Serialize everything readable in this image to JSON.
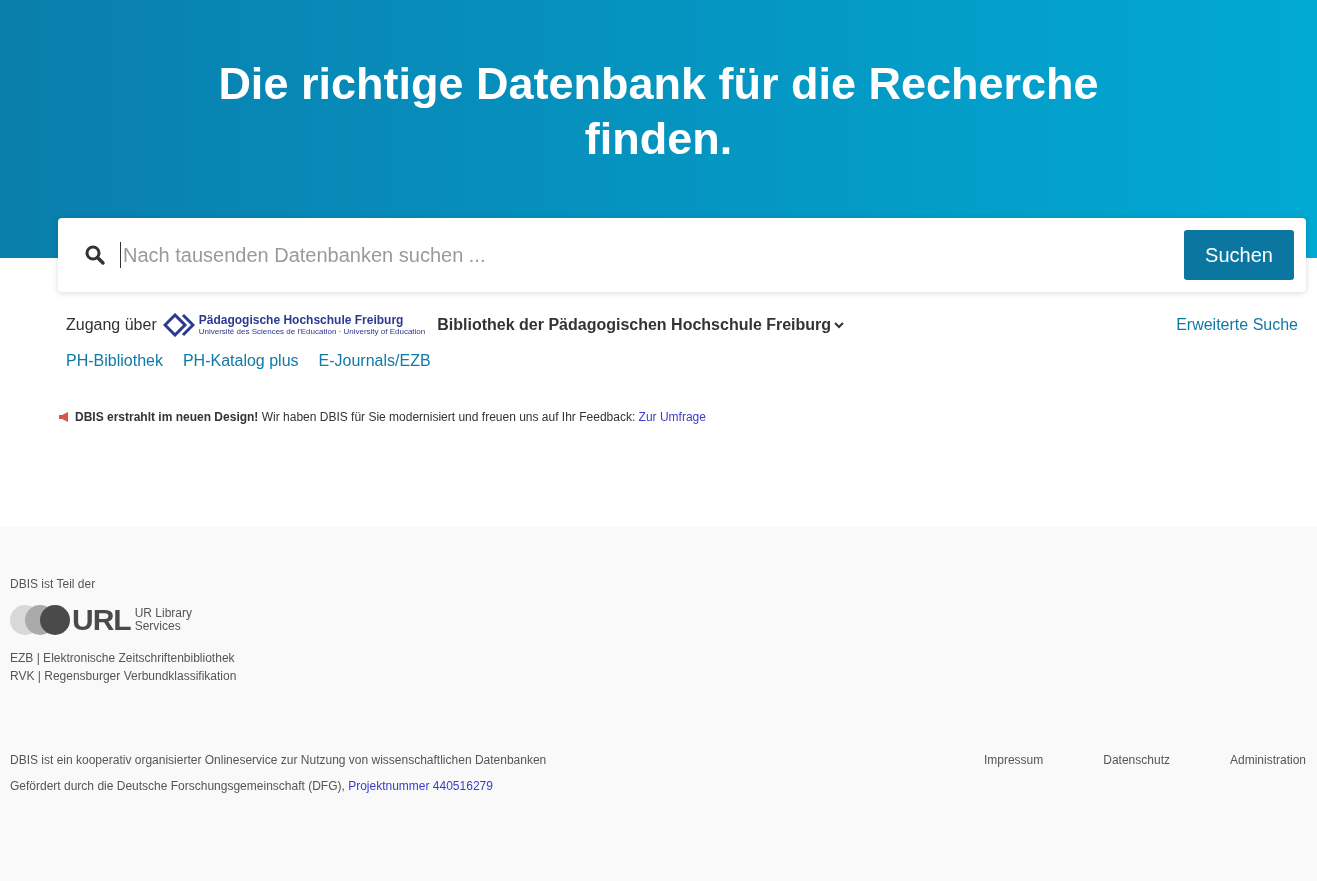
{
  "hero": {
    "title": "Die richtige Datenbank für die Recherche finden."
  },
  "search": {
    "placeholder": "Nach tausenden Datenbanken suchen ...",
    "button": "Suchen"
  },
  "access": {
    "label": "Zugang über",
    "logo_title": "Pädagogische Hochschule Freiburg",
    "logo_subtitle": "Université des Sciences de l'Education · University of Education",
    "institution": "Bibliothek der Pädagogischen Hochschule Freiburg",
    "advanced_search": "Erweiterte Suche"
  },
  "links": [
    "PH-Bibliothek",
    "PH-Katalog plus",
    "E-Journals/EZB"
  ],
  "notice": {
    "text": "**DBIS erstrahlt im neuen Design!** Wir haben DBIS für Sie modernisiert und freuen uns auf Ihr Feedback: ",
    "link": "Zur Umfrage"
  },
  "footer": {
    "part_of": "DBIS ist Teil der",
    "logo_text": "URL",
    "logo_subtitle": [
      "UR Library",
      "Services"
    ],
    "services": [
      "EZB | Elektronische Zeitschriftenbibliothek",
      "RVK | Regensburger Verbundklassifikation"
    ],
    "description": "DBIS ist ein kooperativ organisierter Onlineservice zur Nutzung von wissenschaftlichen Datenbanken",
    "funding": "Gefördert durch die Deutsche Forschungsgemeinschaft (DFG), ",
    "funding_link": "Projektnummer 440516279",
    "nav": [
      "Impressum",
      "Datenschutz",
      "Administration"
    ]
  }
}
